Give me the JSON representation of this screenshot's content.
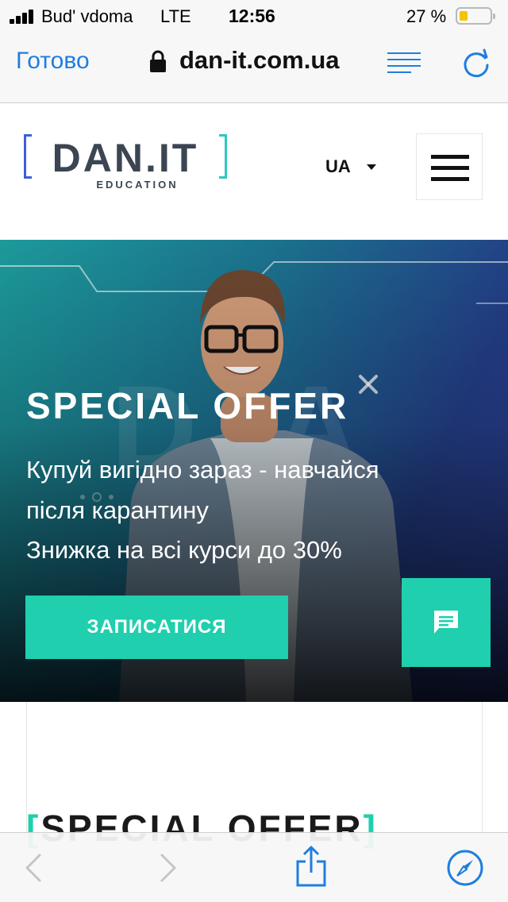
{
  "status_bar": {
    "carrier": "Bud' vdoma",
    "network": "LTE",
    "time": "12:56",
    "battery": "27 %",
    "battery_level": 0.27
  },
  "browser": {
    "done_label": "Готово",
    "url": "dan-it.com.ua",
    "icons": [
      "lock-icon",
      "reader-view-icon",
      "reload-icon"
    ]
  },
  "header": {
    "logo_text": "DAN.IT",
    "logo_subtext": "EDUCATION",
    "language": "UA",
    "menu_icon": "hamburger-menu-icon"
  },
  "hero": {
    "title": "SPECIAL OFFER",
    "line1": "Купуй вигідно зараз - навчайся",
    "line2": "після карантину",
    "line3": "Знижка на всі курси до 30%",
    "cta_label": "ЗАПИСАТИСЯ",
    "chat_icon": "chat-bubble-icon"
  },
  "section": {
    "title": "[SPECIAL OFFER]"
  },
  "toolbar": {
    "icons": [
      "back-icon",
      "forward-icon",
      "share-icon",
      "compass-icon"
    ]
  },
  "colors": {
    "accent": "#1fcfae",
    "ios_blue": "#1e7ee0",
    "logo_dark": "#3b4652"
  }
}
